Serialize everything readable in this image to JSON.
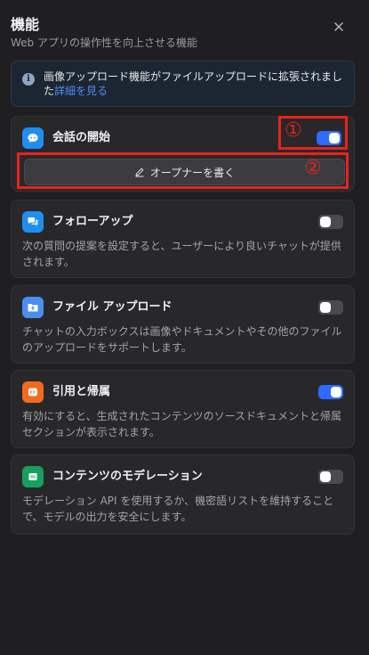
{
  "header": {
    "title": "機能",
    "subtitle": "Web アプリの操作性を向上させる機能",
    "close_icon": "close-icon"
  },
  "notice": {
    "text": "画像アップロード機能がファイルアップロードに拡張されました",
    "link": "詳細を見る",
    "icon": "info-icon"
  },
  "features": [
    {
      "title": "会話の開始",
      "enabled": true,
      "button_label": "オープナーを書く",
      "icon": "chat-bubble-icon",
      "color": "#1f8ef1"
    },
    {
      "title": "フォローアップ",
      "enabled": false,
      "description": "次の質問の提案を設定すると、ユーザーにより良いチャットが提供されます。",
      "icon": "messages-icon",
      "color": "#1f8ef1"
    },
    {
      "title": "ファイル アップロード",
      "enabled": false,
      "description": "チャットの入力ボックスは画像やドキュメントやその他のファイルのアップロードをサポートします。",
      "icon": "folder-upload-icon",
      "color": "#4a8ef0"
    },
    {
      "title": "引用と帰属",
      "enabled": true,
      "description": "有効にすると、生成されたコンテンツのソースドキュメントと帰属セクションが表示されます。",
      "icon": "quote-icon",
      "color": "#f26b1d"
    },
    {
      "title": "コンテンツのモデレーション",
      "enabled": false,
      "description": "モデレーション API を使用するか、機密語リストを維持することで、モデルの出力を安全にします。",
      "icon": "moderation-icon",
      "color": "#17a05d"
    }
  ],
  "annotations": {
    "marker_1": "①",
    "marker_2": "②",
    "color": "#e8221b"
  }
}
